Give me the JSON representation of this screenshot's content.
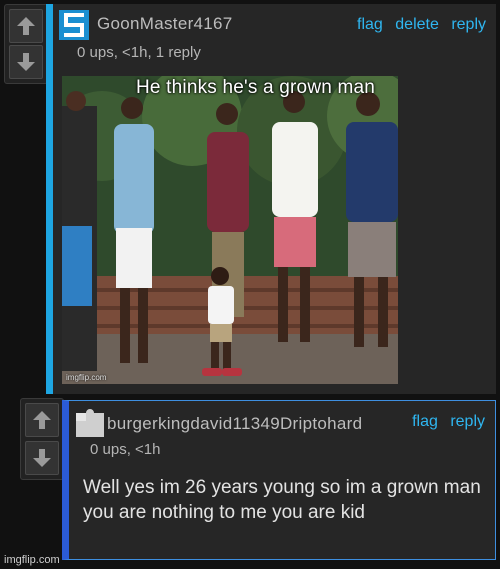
{
  "comment": {
    "username": "GoonMaster4167",
    "meta": "0 ups, <1h, 1 reply",
    "actions": [
      "flag",
      "delete",
      "reply"
    ],
    "avatar_icon": "imgflip-s-logo-icon",
    "meme": {
      "caption": "He thinks he's a grown man",
      "watermark": "imgflip.com"
    }
  },
  "reply": {
    "username": "burgerkingdavid11349Driptohard",
    "meta": "0 ups, <1h",
    "actions": [
      "flag",
      "reply"
    ],
    "avatar_icon": "default-puzzle-avatar-icon",
    "text": "Well yes im 26 years young so im a grown man you are nothing to me you are kid"
  },
  "vote": {
    "up_icon": "upvote-arrow-icon",
    "down_icon": "downvote-arrow-icon"
  },
  "site_watermark": "imgflip.com",
  "colors": {
    "accent": "#1ea6e2",
    "reply_border": "#2b5bd6",
    "action_link": "#2fb6f0",
    "background": "#111111"
  }
}
